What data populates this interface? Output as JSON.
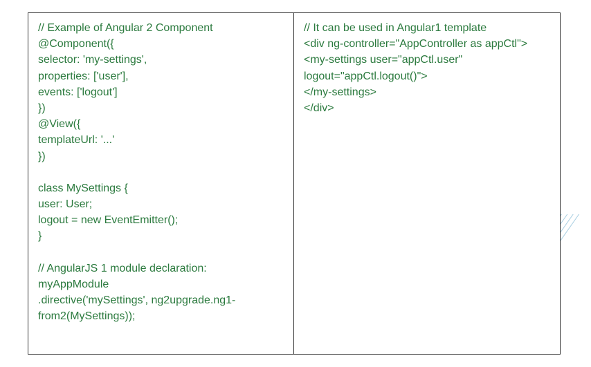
{
  "left": {
    "lines": [
      "// Example of Angular 2 Component",
      "@Component({",
      "selector: 'my-settings',",
      "properties: ['user'],",
      "events: ['logout']",
      "})",
      "@View({",
      "templateUrl: '...'",
      "})",
      "",
      "class MySettings {",
      "user: User;",
      "logout = new EventEmitter();",
      "}",
      "",
      "// AngularJS 1 module declaration:",
      "myAppModule",
      ".directive('mySettings', ng2upgrade.ng1-from2(MySettings));"
    ]
  },
  "right": {
    "lines": [
      "// It can be used in Angular1 template",
      "<div ng-controller=\"AppController as appCtl\">",
      "<my-settings user=\"appCtl.user\" logout=\"appCtl.logout()\">",
      "</my-settings>",
      "</div>"
    ]
  }
}
